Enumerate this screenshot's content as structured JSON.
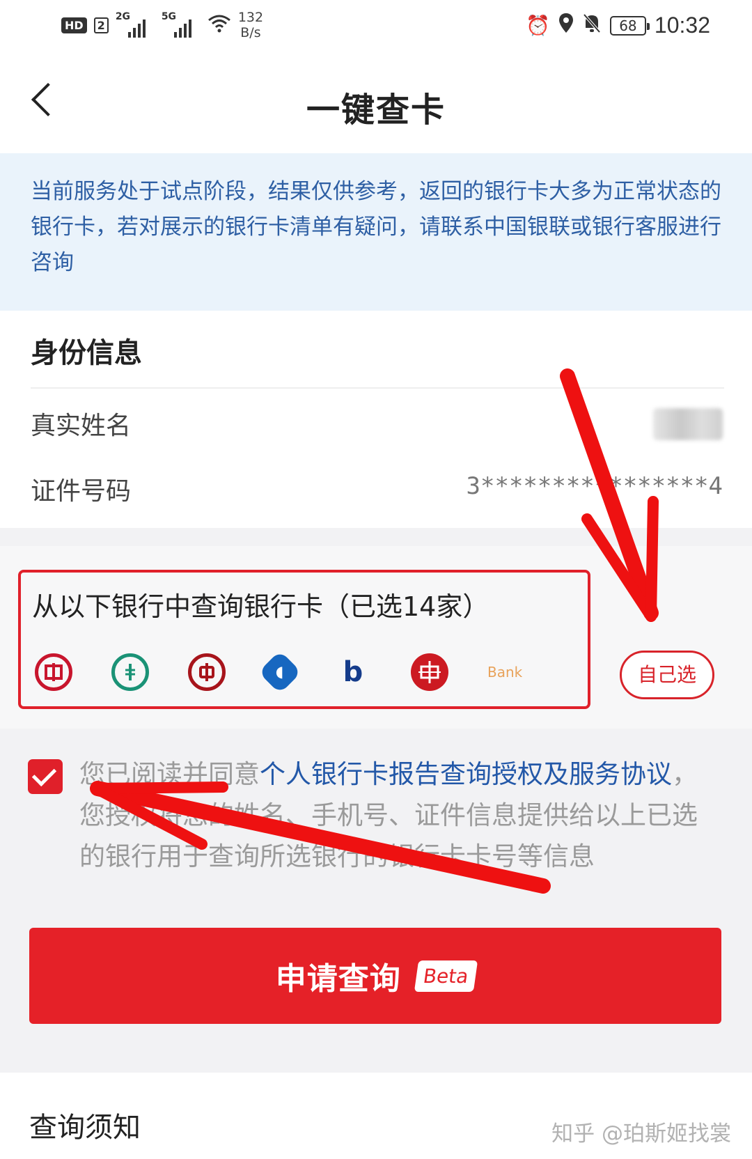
{
  "status_bar": {
    "hd": "HD",
    "sim": "2",
    "net1": "2G",
    "net2": "5G",
    "speed_value": "132",
    "speed_unit": "B/s",
    "battery": "68",
    "time": "10:32"
  },
  "nav": {
    "title": "一键查卡"
  },
  "notice": {
    "text": "当前服务处于试点阶段，结果仅供参考，返回的银行卡大多为正常状态的银行卡，若对展示的银行卡清单有疑问，请联系中国银联或银行客服进行咨询"
  },
  "identity": {
    "title": "身份信息",
    "name_label": "真实姓名",
    "id_label": "证件号码",
    "id_value": "3****************4"
  },
  "banks": {
    "title": "从以下银行中查询银行卡（已选14家）",
    "logos": [
      "ICBC",
      "ABC",
      "BOC",
      "CCB",
      "BOCOM",
      "CITIC",
      "Bank"
    ],
    "choose_label": "自己选"
  },
  "agreement": {
    "prefix": "您已阅读并同意",
    "link": "个人银行卡报告查询授权及服务协议",
    "suffix": "，您授权将您的姓名、手机号、证件信息提供给以上已选的银行用于查询所选银行的银行卡卡号等信息",
    "checked": true
  },
  "submit": {
    "label": "申请查询",
    "badge": "Beta"
  },
  "notes": {
    "title": "查询须知"
  },
  "watermark": {
    "text": "知乎 @珀斯姬找裳"
  },
  "colors": {
    "accent_red": "#e52128",
    "link_blue": "#2358a8",
    "notice_bg": "#eaf3fb"
  }
}
